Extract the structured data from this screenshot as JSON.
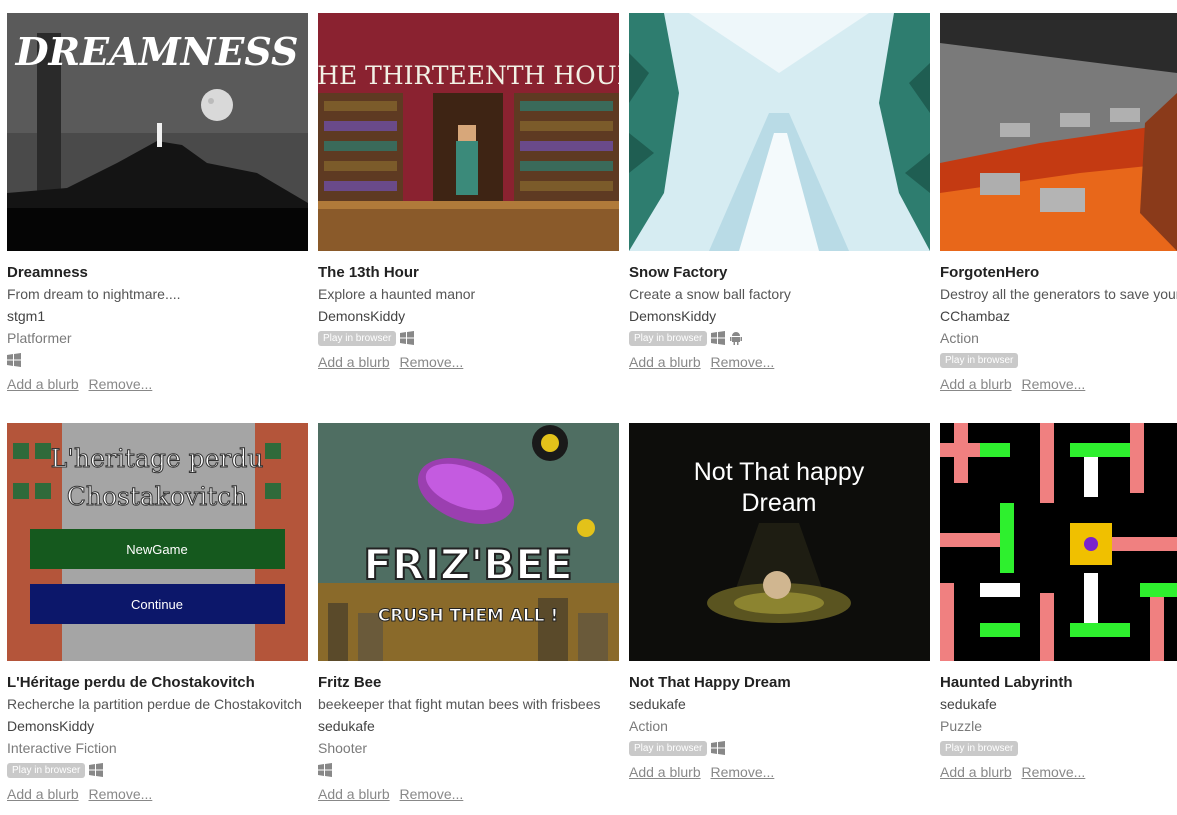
{
  "games": [
    {
      "title": "Dreamness",
      "blurb": "From dream to nightmare....",
      "author": "stgm1",
      "genre": "Platformer",
      "play_in_browser": false,
      "platforms": [
        "windows-icon"
      ]
    },
    {
      "title": "The 13th Hour",
      "blurb": "Explore a haunted manor",
      "author": "DemonsKiddy",
      "genre": "",
      "play_in_browser": true,
      "platforms": [
        "windows-icon"
      ]
    },
    {
      "title": "Snow Factory",
      "blurb": "Create a snow ball factory",
      "author": "DemonsKiddy",
      "genre": "",
      "play_in_browser": true,
      "platforms": [
        "windows-icon",
        "android-icon"
      ]
    },
    {
      "title": "ForgotenHero",
      "blurb": "Destroy all the generators to save your",
      "author": "CChambaz",
      "genre": "Action",
      "play_in_browser": true,
      "platforms": []
    },
    {
      "title": "L'Héritage perdu de Chostakovitch",
      "blurb": "Recherche la partition perdue de Chostakovitch",
      "author": "DemonsKiddy",
      "genre": "Interactive Fiction",
      "play_in_browser": true,
      "platforms": [
        "windows-icon"
      ]
    },
    {
      "title": "Fritz Bee",
      "blurb": "beekeeper that fight mutan bees with frisbees",
      "author": "sedukafe",
      "genre": "Shooter",
      "play_in_browser": false,
      "platforms": [
        "windows-icon"
      ]
    },
    {
      "title": "Not That Happy Dream",
      "blurb": "",
      "author": "sedukafe",
      "genre": "Action",
      "play_in_browser": true,
      "platforms": [
        "windows-icon"
      ]
    },
    {
      "title": "Haunted Labyrinth",
      "blurb": "",
      "author": "sedukafe",
      "genre": "Puzzle",
      "play_in_browser": true,
      "platforms": []
    }
  ],
  "labels": {
    "play_in_browser": "Play in browser",
    "add_blurb": "Add a blurb",
    "remove": "Remove..."
  },
  "thumbnails": {
    "dreamness": {
      "logo": "DREAMNESS"
    },
    "thirteenth": {
      "logo": "THE THIRTEENTH HOUR"
    },
    "heritage": {
      "line1": "L'heritage perdu",
      "line2": "Chostakovitch",
      "btn_new": "NewGame",
      "btn_continue": "Continue"
    },
    "fritz": {
      "logo": "FRIZ'BEE",
      "tagline": "CRUSH THEM ALL !"
    },
    "dream": {
      "line1": "Not That happy",
      "line2": "Dream"
    }
  },
  "colors": {
    "badge": "#c9c9c9",
    "title": "#222222",
    "link": "#888888"
  }
}
